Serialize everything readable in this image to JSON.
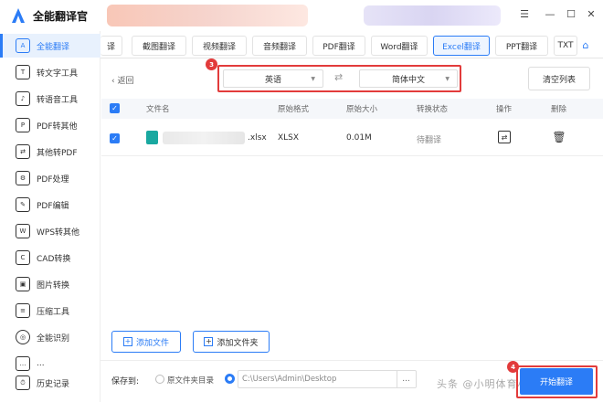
{
  "app": {
    "title": "全能翻译官",
    "logo_icon": "app-logo-icon",
    "accent": "#2b7cf6",
    "highlight": "#e23b3b"
  },
  "window": {
    "menu_icon": "menu-icon",
    "minimize": "minimize-icon",
    "maximize": "maximize-icon",
    "close": "close-icon"
  },
  "sidebar": {
    "items": [
      {
        "label": "全能翻译",
        "icon": "translate-icon",
        "active": true
      },
      {
        "label": "转文字工具",
        "icon": "text-convert-icon"
      },
      {
        "label": "转语音工具",
        "icon": "voice-icon"
      },
      {
        "label": "PDF转其他",
        "icon": "pdf-convert-icon"
      },
      {
        "label": "其他转PDF",
        "icon": "to-pdf-icon"
      },
      {
        "label": "PDF处理",
        "icon": "pdf-process-icon"
      },
      {
        "label": "PDF编辑",
        "icon": "pdf-edit-icon"
      },
      {
        "label": "WPS转其他",
        "icon": "wps-icon"
      },
      {
        "label": "CAD转换",
        "icon": "cad-icon"
      },
      {
        "label": "图片转换",
        "icon": "image-icon"
      },
      {
        "label": "压缩工具",
        "icon": "compress-icon"
      },
      {
        "label": "全能识别",
        "icon": "recognize-icon"
      },
      {
        "label": "...",
        "icon": "more-icon"
      },
      {
        "label": "历史记录",
        "icon": "history-icon"
      }
    ]
  },
  "tabs": [
    {
      "label": "译"
    },
    {
      "label": "截图翻译"
    },
    {
      "label": "视频翻译"
    },
    {
      "label": "音频翻译"
    },
    {
      "label": "PDF翻译"
    },
    {
      "label": "Word翻译"
    },
    {
      "label": "Excel翻译",
      "active": true
    },
    {
      "label": "PPT翻译"
    },
    {
      "label": "TXT"
    }
  ],
  "toolbar": {
    "back_label": "返回",
    "source_lang": "英语",
    "target_lang": "简体中文",
    "swap_icon": "swap-arrows-icon",
    "clear_label": "清空列表",
    "step3": "3",
    "step4": "4"
  },
  "table": {
    "columns": [
      "文件名",
      "原始格式",
      "原始大小",
      "转换状态",
      "操作",
      "删除"
    ],
    "rows": [
      {
        "name_ext": ".xlsx",
        "format": "XLSX",
        "size": "0.01M",
        "status": "待翻译"
      }
    ]
  },
  "actions": {
    "add_file": "添加文件",
    "add_folder": "添加文件夹"
  },
  "output": {
    "save_label": "保存到:",
    "option_source": "原文件夹目录",
    "path": "C:\\Users\\Admin\\Desktop",
    "browse": "...",
    "start_label": "开始翻译"
  },
  "watermark": "头条 @小明体育小课堂"
}
